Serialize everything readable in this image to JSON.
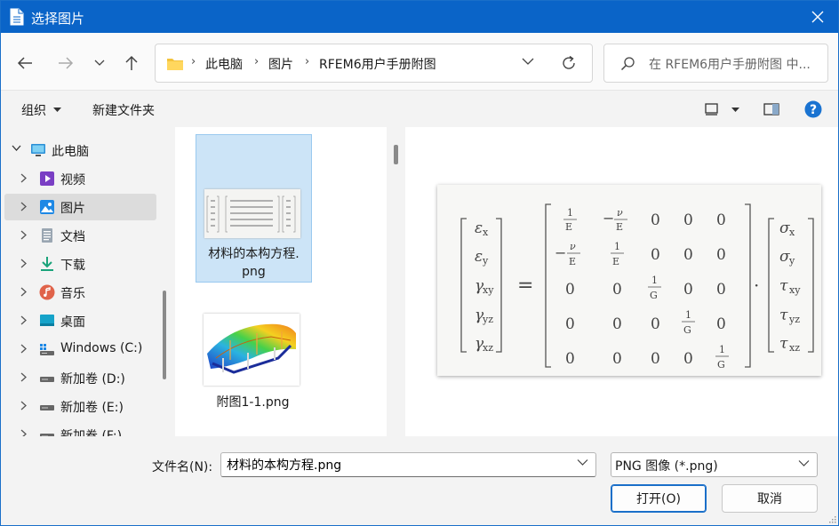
{
  "window": {
    "title": "选择图片"
  },
  "address": {
    "crumbs": [
      "此电脑",
      "图片",
      "RFEM6用户手册附图"
    ],
    "search_placeholder": "在 RFEM6用户手册附图 中..."
  },
  "toolbar": {
    "organize": "组织",
    "new_folder": "新建文件夹"
  },
  "sidebar": {
    "items": [
      {
        "label": "此电脑",
        "icon": "computer-icon"
      },
      {
        "label": "视频",
        "icon": "video-icon"
      },
      {
        "label": "图片",
        "icon": "pictures-icon"
      },
      {
        "label": "文档",
        "icon": "documents-icon"
      },
      {
        "label": "下载",
        "icon": "download-icon"
      },
      {
        "label": "音乐",
        "icon": "music-icon"
      },
      {
        "label": "桌面",
        "icon": "desktop-icon"
      },
      {
        "label": "Windows (C:)",
        "icon": "drive-icon"
      },
      {
        "label": "新加卷 (D:)",
        "icon": "drive-icon"
      },
      {
        "label": "新加卷 (E:)",
        "icon": "drive-icon"
      },
      {
        "label": "新加卷 (F:)",
        "icon": "drive-icon"
      }
    ]
  },
  "files": [
    {
      "name_line1": "材料的本构方程.",
      "name_line2": "png"
    },
    {
      "name_line1": "附图1-1.png",
      "name_line2": ""
    }
  ],
  "preview": {
    "lhs": [
      "ε",
      "ε",
      "γ",
      "γ",
      "γ"
    ],
    "lhs_sub": [
      "x",
      "y",
      "xy",
      "yz",
      "xz"
    ],
    "rhs": [
      "σ",
      "σ",
      "τ",
      "τ",
      "τ"
    ],
    "rhs_sub": [
      "x",
      "y",
      "xy",
      "yz",
      "xz"
    ],
    "numerator": "1",
    "den_E": "E",
    "den_G": "G",
    "nu": "ν",
    "minus": "−",
    "zero": "0",
    "equals": "=",
    "dot": "·"
  },
  "bottom": {
    "filename_label": "文件名(N):",
    "filename_value": "材料的本构方程.png",
    "filetype": "PNG 图像 (*.png)",
    "open_label": "打开(O)",
    "cancel_label": "取消"
  }
}
